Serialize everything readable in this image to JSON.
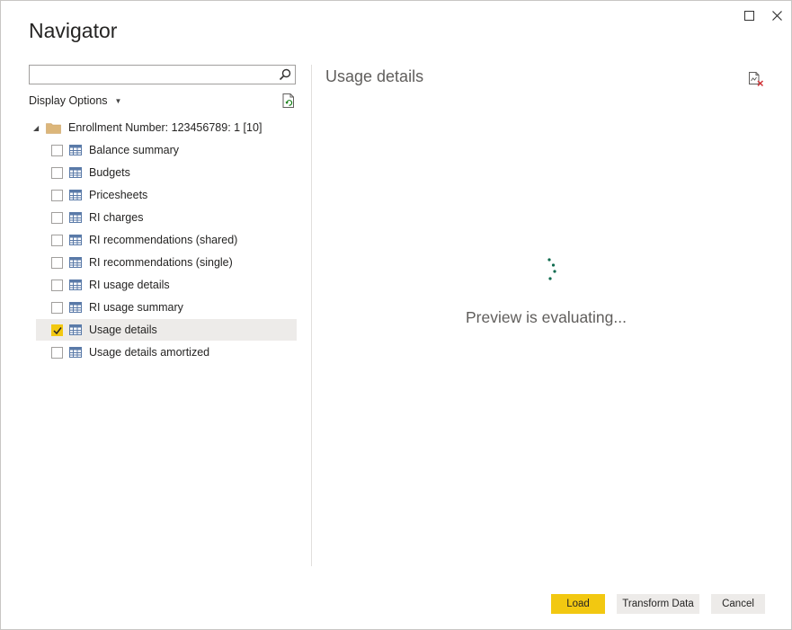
{
  "window": {
    "title": "Navigator",
    "maximize_icon": "maximize-icon",
    "close_icon": "close-icon"
  },
  "left_pane": {
    "search": {
      "value": "",
      "placeholder": ""
    },
    "display_options_label": "Display Options",
    "tree": {
      "root_label": "Enrollment Number: 123456789: 1 [10]",
      "items": [
        {
          "label": "Balance summary",
          "checked": false
        },
        {
          "label": "Budgets",
          "checked": false
        },
        {
          "label": "Pricesheets",
          "checked": false
        },
        {
          "label": "RI charges",
          "checked": false
        },
        {
          "label": "RI recommendations (shared)",
          "checked": false
        },
        {
          "label": "RI recommendations (single)",
          "checked": false
        },
        {
          "label": "RI usage details",
          "checked": false
        },
        {
          "label": "RI usage summary",
          "checked": false
        },
        {
          "label": "Usage details",
          "checked": true
        },
        {
          "label": "Usage details amortized",
          "checked": false
        }
      ]
    }
  },
  "right_pane": {
    "preview_title": "Usage details",
    "status_text": "Preview is evaluating..."
  },
  "footer": {
    "load_label": "Load",
    "transform_label": "Transform Data",
    "cancel_label": "Cancel"
  },
  "colors": {
    "accent": "#f2c811",
    "selected_row": "#edebe9",
    "spinner": "#0f6b4f",
    "folder": "#dcb67a"
  }
}
